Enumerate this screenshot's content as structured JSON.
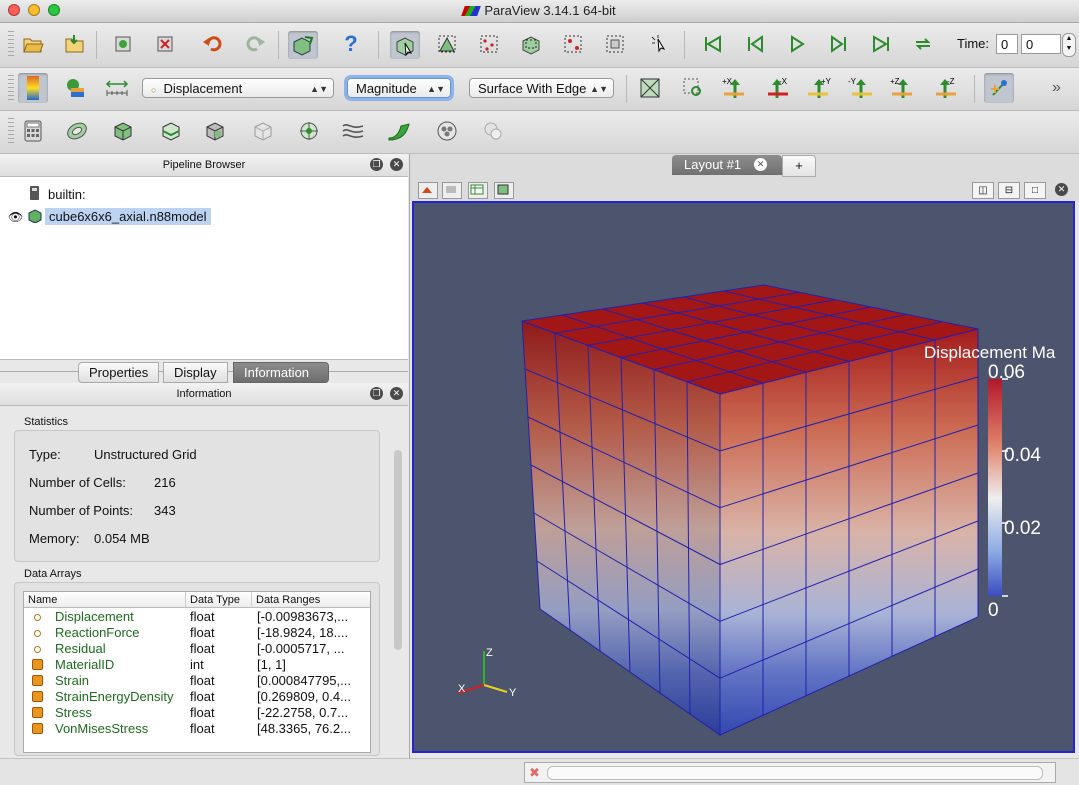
{
  "window": {
    "title": "ParaView 3.14.1 64-bit"
  },
  "toolbar1": {
    "time_label": "Time:",
    "time_value": "0",
    "time_step": "0"
  },
  "toolbar2": {
    "array_combo": "Displacement",
    "component_combo": "Magnitude",
    "representation_combo": "Surface With Edges",
    "overflow": "»"
  },
  "pipeline": {
    "title": "Pipeline Browser",
    "items": [
      {
        "label": "builtin:"
      },
      {
        "label": "cube6x6x6_axial.n88model"
      }
    ]
  },
  "tabs": [
    "Properties",
    "Display",
    "Information"
  ],
  "information": {
    "title": "Information",
    "statistics_title": "Statistics",
    "type_label": "Type:",
    "type_value": "Unstructured Grid",
    "cells_label": "Number of Cells:",
    "cells_value": "216",
    "points_label": "Number of Points:",
    "points_value": "343",
    "memory_label": "Memory:",
    "memory_value": "0.054 MB",
    "arrays_title": "Data Arrays",
    "columns": [
      "Name",
      "Data Type",
      "Data Ranges"
    ],
    "rows": [
      {
        "name": "Displacement",
        "type": "float",
        "range": "[-0.00983673,...",
        "icon": "point-data-icon"
      },
      {
        "name": "ReactionForce",
        "type": "float",
        "range": "[-18.9824, 18....",
        "icon": "point-data-icon"
      },
      {
        "name": "Residual",
        "type": "float",
        "range": "[-0.0005717, ...",
        "icon": "point-data-icon"
      },
      {
        "name": "MaterialID",
        "type": "int",
        "range": "[1, 1]",
        "icon": "cell-data-icon"
      },
      {
        "name": "Strain",
        "type": "float",
        "range": "[0.000847795,...",
        "icon": "cell-data-icon"
      },
      {
        "name": "StrainEnergyDensity",
        "type": "float",
        "range": "[0.269809, 0.4...",
        "icon": "cell-data-icon"
      },
      {
        "name": "Stress",
        "type": "float",
        "range": "[-22.2758, 0.7...",
        "icon": "cell-data-icon"
      },
      {
        "name": "VonMisesStress",
        "type": "float",
        "range": "[48.3365, 76.2...",
        "icon": "cell-data-icon"
      }
    ]
  },
  "layout": {
    "tab_label": "Layout #1",
    "add_tab": "+"
  },
  "view": {
    "background": "#4d546d",
    "colorbar": {
      "title": "Displacement Ma",
      "labels": [
        "0.06",
        "0.04",
        "0.02",
        "0"
      ],
      "max": 0.06,
      "min": 0
    },
    "axes": {
      "x": "X",
      "y": "Y",
      "z": "Z"
    }
  }
}
